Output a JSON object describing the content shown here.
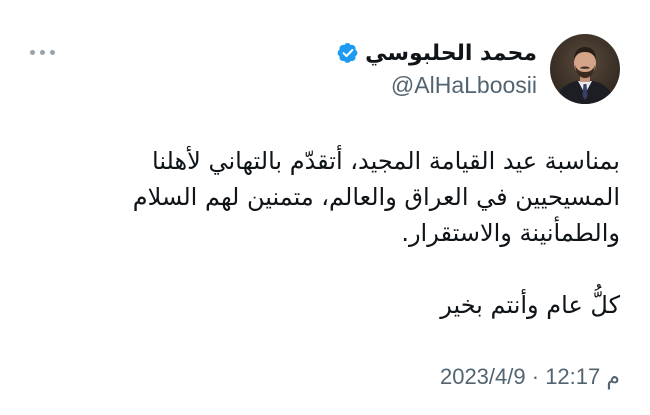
{
  "author": {
    "display_name": "محمد الحلبوسي",
    "handle": "@AlHaLboosii",
    "verified": true,
    "verified_color": "#1d9bf0",
    "avatar": "profile-photo"
  },
  "tweet": {
    "lines": [
      "بمناسبة عيد القيامة المجيد، أتقدّم بالتهاني لأهلنا",
      "المسيحيين في العراق والعالم، متمنين لهم السلام",
      "والطمأنينة والاستقرار.",
      "كلُّ عام وأنتم بخير"
    ]
  },
  "timestamp": {
    "meridiem": "م",
    "time": "12:17",
    "separator": "·",
    "date": "2023/4/9"
  },
  "menu": {
    "icon": "more-horizontal-icon"
  }
}
